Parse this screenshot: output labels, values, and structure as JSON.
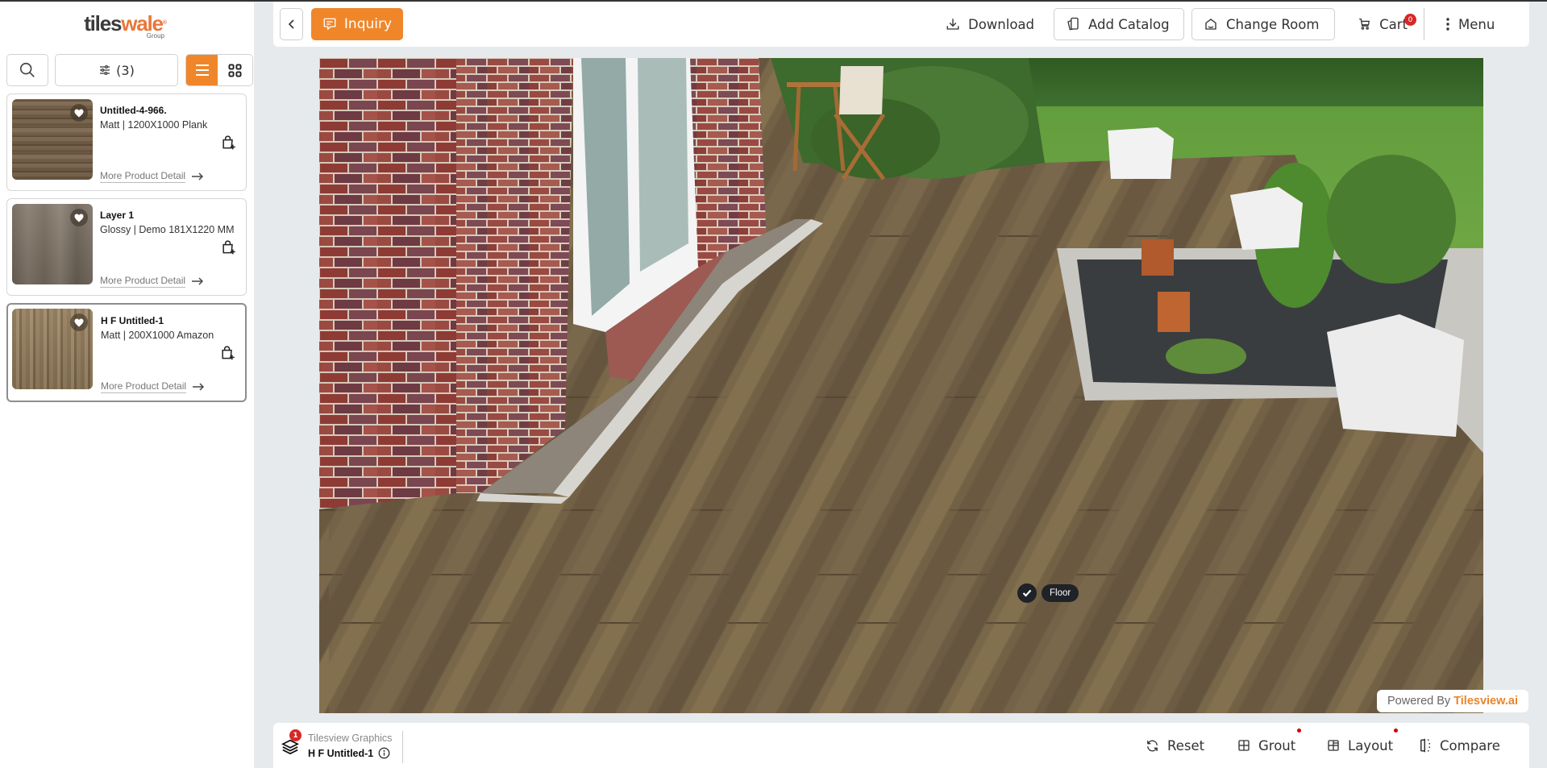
{
  "brand": {
    "logo_primary": "tiles",
    "logo_accent": "wale",
    "logo_reg": "®",
    "logo_sub": "Group",
    "accent_color": "#f0862a"
  },
  "sidebar": {
    "filter_label": "(3)",
    "view_mode": "list",
    "products": [
      {
        "name": "Untitled-4-966.",
        "desc": "Matt | 1200X1000 Plank",
        "more": "More Product Detail",
        "selected": false
      },
      {
        "name": "Layer 1",
        "desc": "Glossy | Demo 181X1220 MM",
        "more": "More Product Detail",
        "selected": false
      },
      {
        "name": "H F Untitled-1",
        "desc": "Matt | 200X1000 Amazon",
        "more": "More Product Detail",
        "selected": true
      }
    ]
  },
  "topbar": {
    "inquiry_label": "Inquiry",
    "download_label": "Download",
    "add_catalog_label": "Add Catalog",
    "change_room_label": "Change Room",
    "cart_label": "Cart",
    "cart_count": "0",
    "menu_label": "Menu"
  },
  "scene": {
    "surface_label": "Floor",
    "surface_selected": true
  },
  "powered": {
    "prefix": "Powered By",
    "brand": "Tilesview.ai"
  },
  "bottombar": {
    "layers_count": "1",
    "brand_line": "Tilesview Graphics",
    "current_tile": "H F Untitled-1",
    "reset_label": "Reset",
    "grout_label": "Grout",
    "layout_label": "Layout",
    "compare_label": "Compare"
  }
}
